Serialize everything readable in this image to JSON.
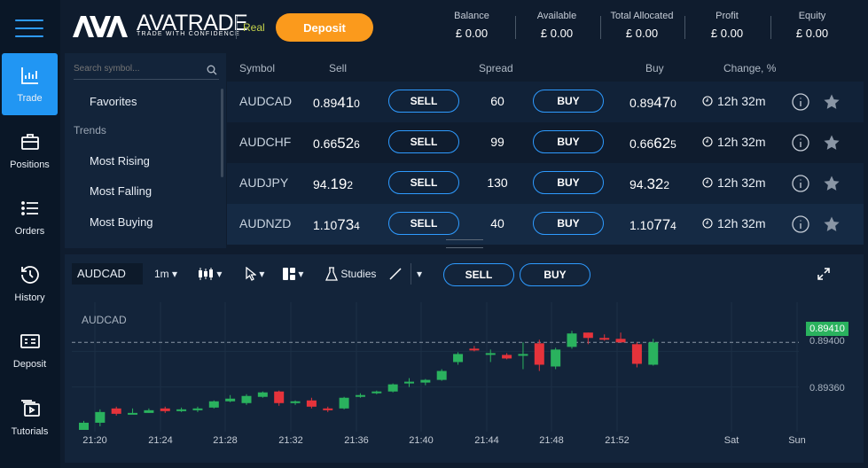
{
  "sidebar": {
    "items": [
      {
        "label": "Trade",
        "icon": "bar-chart-icon"
      },
      {
        "label": "Positions",
        "icon": "briefcase-icon"
      },
      {
        "label": "Orders",
        "icon": "list-icon"
      },
      {
        "label": "History",
        "icon": "history-icon"
      },
      {
        "label": "Deposit",
        "icon": "cash-icon"
      },
      {
        "label": "Tutorials",
        "icon": "video-icon"
      }
    ]
  },
  "header": {
    "brand": "AVATRADE",
    "tagline": "TRADE WITH CONFIDENCE",
    "mode": "Real",
    "deposit_label": "Deposit"
  },
  "stats": [
    {
      "label": "Balance",
      "value": "£ 0.00"
    },
    {
      "label": "Available",
      "value": "£ 0.00"
    },
    {
      "label": "Total Allocated",
      "value": "£ 0.00"
    },
    {
      "label": "Profit",
      "value": "£ 0.00"
    },
    {
      "label": "Equity",
      "value": "£ 0.00"
    }
  ],
  "panel": {
    "search_placeholder": "Search symbol...",
    "favorites": "Favorites",
    "trends": "Trends",
    "items": [
      "Most Rising",
      "Most Falling",
      "Most Buying"
    ]
  },
  "quotes": {
    "headers": {
      "symbol": "Symbol",
      "sell": "Sell",
      "spread": "Spread",
      "buy": "Buy",
      "change": "Change, %"
    },
    "sell_label": "SELL",
    "buy_label": "BUY",
    "rows": [
      {
        "symbol": "AUDCAD",
        "sell": [
          "0.89",
          "41",
          "0"
        ],
        "spread": "60",
        "buy": [
          "0.89",
          "47",
          "0"
        ],
        "change": "12h 32m"
      },
      {
        "symbol": "AUDCHF",
        "sell": [
          "0.66",
          "52",
          "6"
        ],
        "spread": "99",
        "buy": [
          "0.66",
          "62",
          "5"
        ],
        "change": "12h 32m"
      },
      {
        "symbol": "AUDJPY",
        "sell": [
          "94.",
          "19",
          "2"
        ],
        "spread": "130",
        "buy": [
          "94.",
          "32",
          "2"
        ],
        "change": "12h 32m"
      },
      {
        "symbol": "AUDNZD",
        "sell": [
          "1.10",
          "73",
          "4"
        ],
        "spread": "40",
        "buy": [
          "1.10",
          "77",
          "4"
        ],
        "change": "12h 32m"
      }
    ]
  },
  "chart_toolbar": {
    "symbol": "AUDCAD",
    "interval": "1m",
    "studies": "Studies",
    "sell_label": "SELL",
    "buy_label": "BUY"
  },
  "chart_data": {
    "type": "candlestick",
    "symbol_label": "AUDCAD",
    "current_price": "0.89410",
    "y_ticks": [
      "0.89400",
      "0.89360"
    ],
    "x_ticks": [
      "21:20",
      "21:24",
      "21:28",
      "21:32",
      "21:36",
      "21:40",
      "21:44",
      "21:48",
      "21:52",
      "Sat",
      "Sun"
    ],
    "ylim": [
      0.8931,
      0.89455
    ],
    "up_color": "#2ab25e",
    "down_color": "#e5333b",
    "candles": [
      {
        "o": 0.89312,
        "h": 0.89322,
        "l": 0.89312,
        "c": 0.8932
      },
      {
        "o": 0.8932,
        "h": 0.89335,
        "l": 0.89316,
        "c": 0.89332
      },
      {
        "o": 0.89336,
        "h": 0.89338,
        "l": 0.89328,
        "c": 0.8933
      },
      {
        "o": 0.8933,
        "h": 0.89336,
        "l": 0.8933,
        "c": 0.89331
      },
      {
        "o": 0.89331,
        "h": 0.89336,
        "l": 0.89331,
        "c": 0.89334
      },
      {
        "o": 0.89336,
        "h": 0.89338,
        "l": 0.89331,
        "c": 0.89333
      },
      {
        "o": 0.89333,
        "h": 0.89337,
        "l": 0.89332,
        "c": 0.89335
      },
      {
        "o": 0.89334,
        "h": 0.89338,
        "l": 0.89332,
        "c": 0.89336
      },
      {
        "o": 0.89337,
        "h": 0.89345,
        "l": 0.89336,
        "c": 0.89344
      },
      {
        "o": 0.89344,
        "h": 0.89351,
        "l": 0.89343,
        "c": 0.89347
      },
      {
        "o": 0.89342,
        "h": 0.89352,
        "l": 0.8934,
        "c": 0.8935
      },
      {
        "o": 0.89349,
        "h": 0.89355,
        "l": 0.89348,
        "c": 0.89354
      },
      {
        "o": 0.89355,
        "h": 0.89356,
        "l": 0.89339,
        "c": 0.89342
      },
      {
        "o": 0.89342,
        "h": 0.89345,
        "l": 0.8934,
        "c": 0.89344
      },
      {
        "o": 0.89345,
        "h": 0.89348,
        "l": 0.89336,
        "c": 0.89338
      },
      {
        "o": 0.89336,
        "h": 0.89338,
        "l": 0.89332,
        "c": 0.89335
      },
      {
        "o": 0.89336,
        "h": 0.89349,
        "l": 0.89335,
        "c": 0.89348
      },
      {
        "o": 0.89349,
        "h": 0.89353,
        "l": 0.89348,
        "c": 0.89351
      },
      {
        "o": 0.89354,
        "h": 0.89356,
        "l": 0.89352,
        "c": 0.89355
      },
      {
        "o": 0.89355,
        "h": 0.89364,
        "l": 0.89354,
        "c": 0.89363
      },
      {
        "o": 0.89364,
        "h": 0.8937,
        "l": 0.8936,
        "c": 0.89366
      },
      {
        "o": 0.89365,
        "h": 0.89369,
        "l": 0.89362,
        "c": 0.89368
      },
      {
        "o": 0.89368,
        "h": 0.8938,
        "l": 0.89367,
        "c": 0.89378
      },
      {
        "o": 0.89388,
        "h": 0.89399,
        "l": 0.89385,
        "c": 0.89397
      },
      {
        "o": 0.89403,
        "h": 0.89406,
        "l": 0.894,
        "c": 0.89402
      },
      {
        "o": 0.89398,
        "h": 0.89402,
        "l": 0.89388,
        "c": 0.89398
      },
      {
        "o": 0.89396,
        "h": 0.89398,
        "l": 0.89391,
        "c": 0.89392
      },
      {
        "o": 0.89397,
        "h": 0.8941,
        "l": 0.8938,
        "c": 0.89397
      },
      {
        "o": 0.89409,
        "h": 0.89413,
        "l": 0.89378,
        "c": 0.89385
      },
      {
        "o": 0.89383,
        "h": 0.89404,
        "l": 0.8938,
        "c": 0.89402
      },
      {
        "o": 0.89405,
        "h": 0.89423,
        "l": 0.89403,
        "c": 0.8942
      },
      {
        "o": 0.89421,
        "h": 0.89421,
        "l": 0.89408,
        "c": 0.89415
      },
      {
        "o": 0.89415,
        "h": 0.89419,
        "l": 0.89412,
        "c": 0.89413
      },
      {
        "o": 0.89414,
        "h": 0.89421,
        "l": 0.8941,
        "c": 0.8941
      },
      {
        "o": 0.89408,
        "h": 0.8941,
        "l": 0.89382,
        "c": 0.89386
      },
      {
        "o": 0.89385,
        "h": 0.89414,
        "l": 0.89384,
        "c": 0.8941
      }
    ]
  }
}
